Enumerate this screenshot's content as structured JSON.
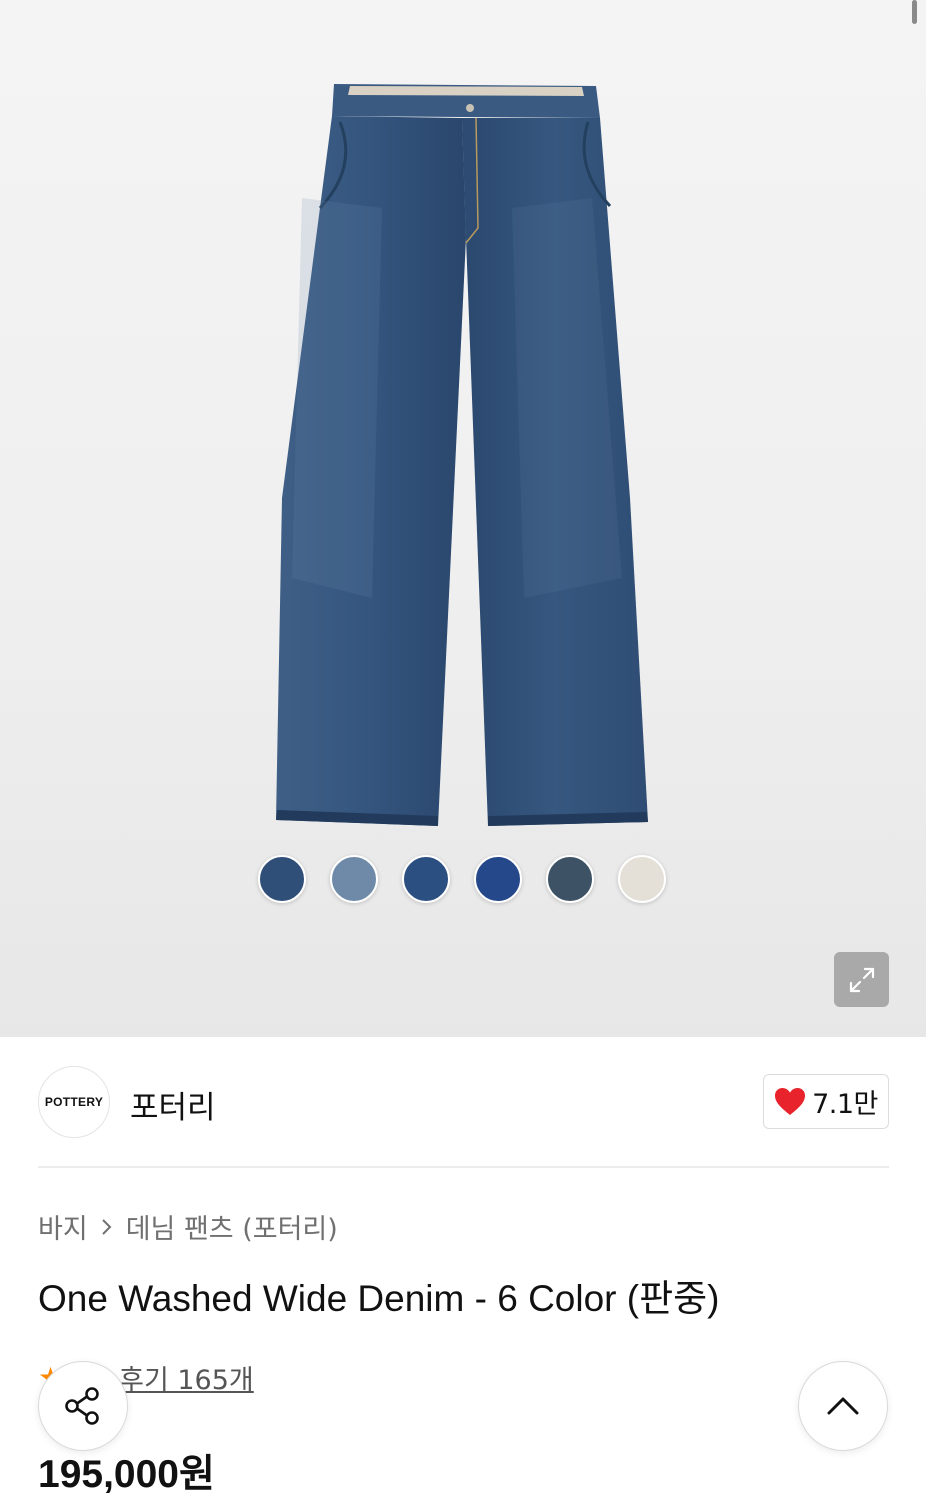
{
  "product": {
    "image_icon": "wide-denim-jeans-photo",
    "swatches": [
      {
        "color": "#2f4f78"
      },
      {
        "color": "#6f8aa8"
      },
      {
        "color": "#2c4f82"
      },
      {
        "color": "#25488a"
      },
      {
        "color": "#3d5264"
      },
      {
        "color": "#e4e0d8"
      }
    ],
    "expand_icon": "expand-arrows-icon"
  },
  "brand": {
    "logo_text": "POTTERY",
    "name": "포터리",
    "likes": "7.1만",
    "like_icon": "heart-icon",
    "like_color": "#e8232b"
  },
  "breadcrumb": {
    "category": "바지",
    "separator_icon": "chevron-right-icon",
    "subcategory": "데님 팬츠 (포터리)"
  },
  "title": "One Washed Wide Denim - 6 Color (판중)",
  "rating": {
    "star_icon": "star-icon",
    "star_color": "#ff8a00",
    "reviews_label": "후기 165개"
  },
  "price": "195,000원",
  "fabs": {
    "share_icon": "share-icon",
    "scroll_top_icon": "chevron-up-icon"
  }
}
